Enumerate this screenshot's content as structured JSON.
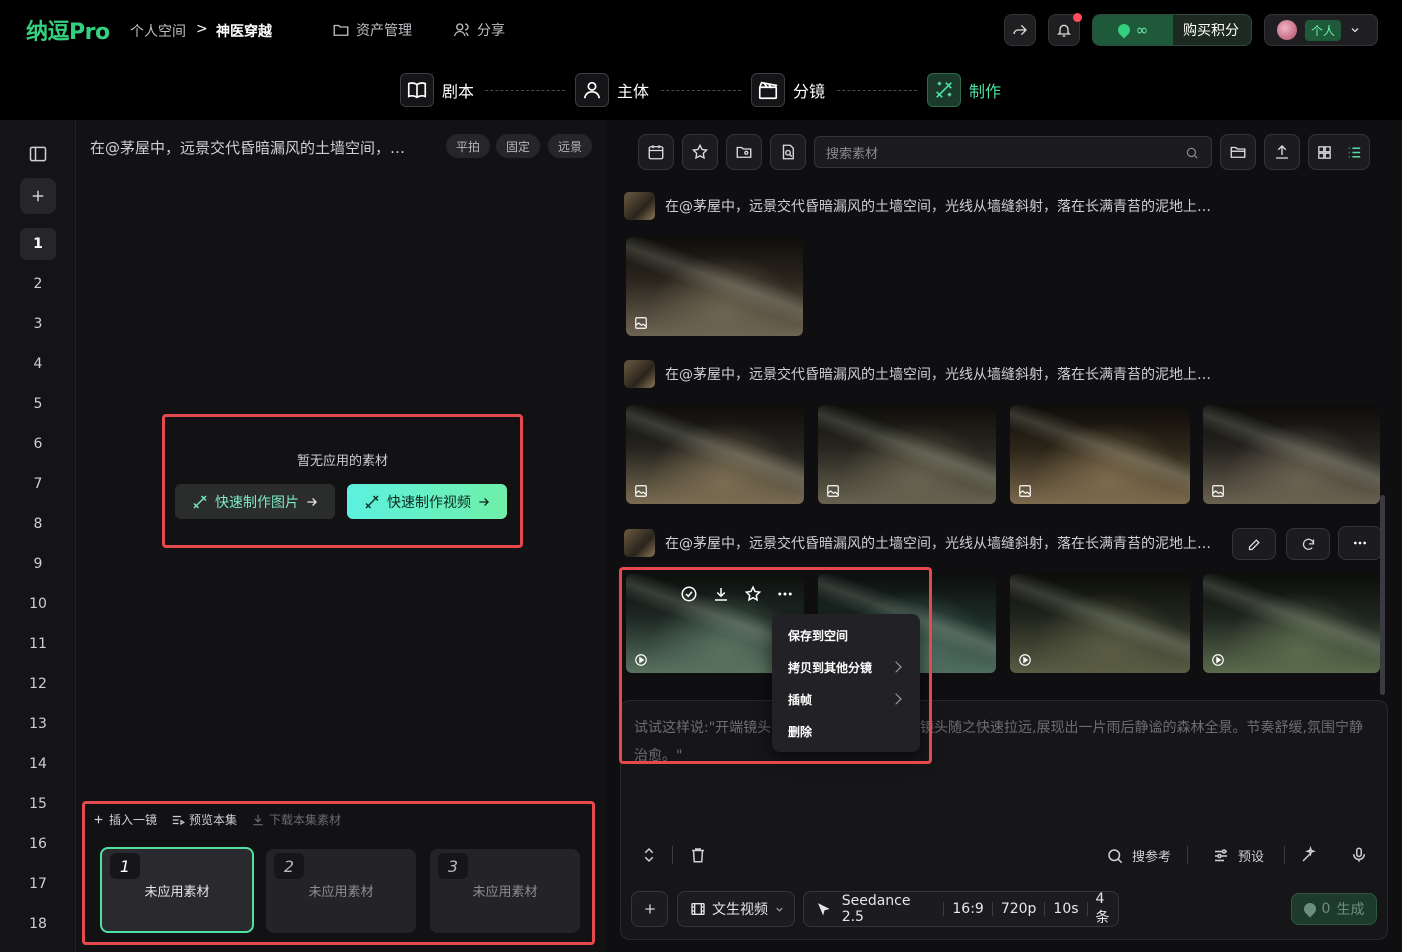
{
  "brand": {
    "logo": "纳逗Pro"
  },
  "breadcrumb": {
    "space": "个人空间",
    "sep": ">",
    "project": "神医穿越"
  },
  "nav": {
    "assets": "资产管理",
    "share": "分享"
  },
  "header": {
    "credits": "∞",
    "buy": "购买积分",
    "account": "个人"
  },
  "steps": [
    {
      "label": "剧本",
      "icon": "book-icon"
    },
    {
      "label": "主体",
      "icon": "user-icon"
    },
    {
      "label": "分镜",
      "icon": "clapper-icon"
    },
    {
      "label": "制作",
      "icon": "magic-icon"
    }
  ],
  "sidebar": {
    "shots": [
      "1",
      "2",
      "3",
      "4",
      "5",
      "6",
      "7",
      "8",
      "9",
      "10",
      "11",
      "12",
      "13",
      "14",
      "15",
      "16",
      "17",
      "18"
    ],
    "active": "1"
  },
  "shot": {
    "prompt": "在@茅屋中，远景交代昏暗漏风的土墙空间，…",
    "tags": [
      "平拍",
      "固定",
      "远景"
    ],
    "empty": "暂无应用的素材",
    "quick_image": "快速制作图片",
    "quick_video": "快速制作视频"
  },
  "episode": {
    "insert": "插入一镜",
    "preview": "预览本集",
    "download": "下载本集素材",
    "cards": [
      {
        "num": "1",
        "label": "未应用素材"
      },
      {
        "num": "2",
        "label": "未应用素材"
      },
      {
        "num": "3",
        "label": "未应用素材"
      }
    ]
  },
  "library": {
    "search_placeholder": "搜索素材",
    "prompt_text": "在@茅屋中，远景交代昏暗漏风的土墙空间，光线从墙缝斜射，落在长满青苔的泥地上…"
  },
  "context_menu": [
    "保存到空间",
    "拷贝到其他分镜",
    "插帧",
    "删除"
  ],
  "composer": {
    "placeholder": "试试这样说:\"开端镜头…静湖面,接着涟漪荡开,镜头随之快速拉远,展现出一片雨后静谧的森林全景。节奏舒缓,氛围宁静治愈。\"",
    "search_ref": "搜参考",
    "preset": "预设",
    "mode": "文生视频",
    "model": "Seedance 2.5",
    "ratio": "16:9",
    "resolution": "720p",
    "duration": "10s",
    "count": "4条",
    "generate_cost": "0",
    "generate": "生成"
  }
}
